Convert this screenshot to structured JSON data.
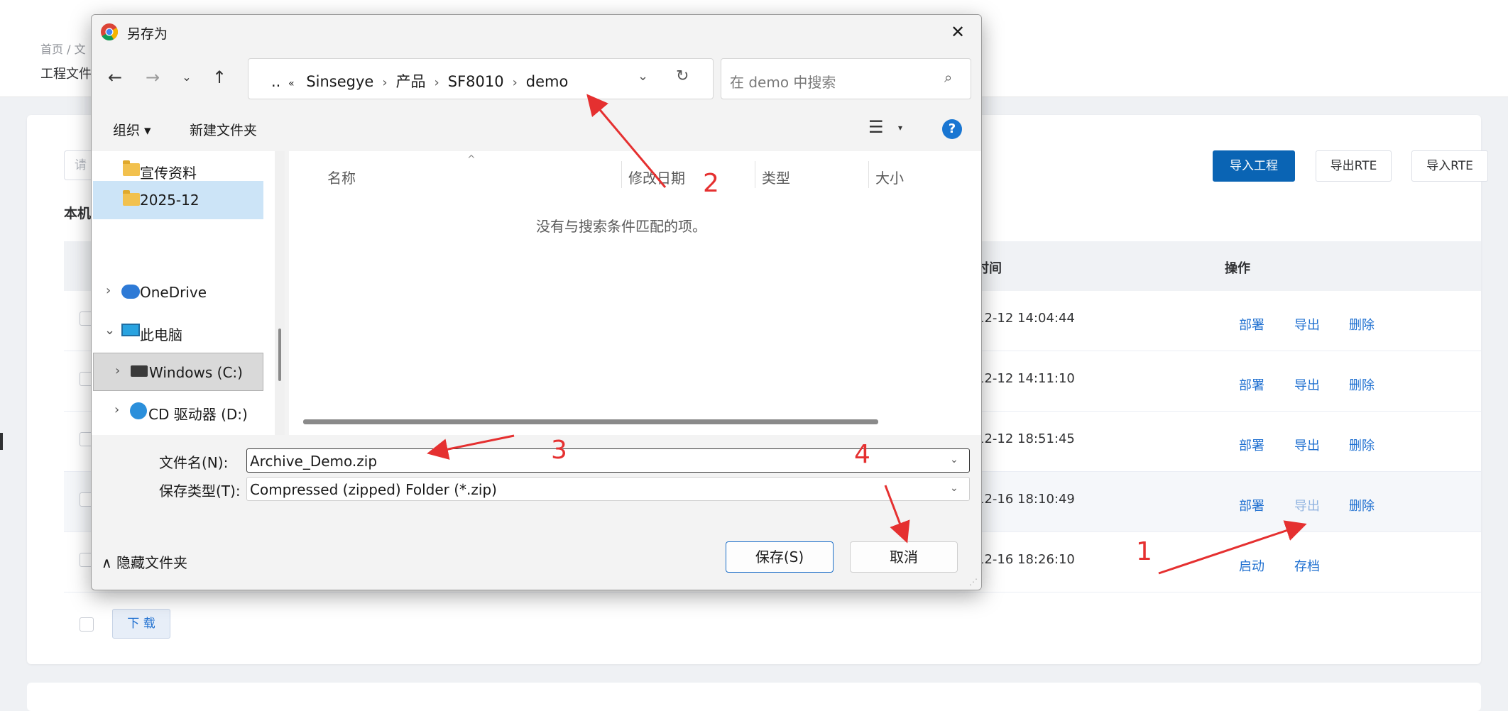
{
  "background": {
    "breadcrumb": "首页 / 文",
    "page_title": "工程文件",
    "search_placeholder": "请",
    "section_label": "本机",
    "toolbar": {
      "import_project": "导入工程",
      "export_rte": "导出RTE",
      "import_rte": "导入RTE"
    },
    "table": {
      "col_time": "时间",
      "col_ops": "操作",
      "rows": [
        {
          "time": "12-12 14:04:44",
          "ops": [
            "部署",
            "导出",
            "删除"
          ]
        },
        {
          "time": "12-12 14:11:10",
          "ops": [
            "部署",
            "导出",
            "删除"
          ]
        },
        {
          "time": "12-12 18:51:45",
          "ops": [
            "部署",
            "导出",
            "删除"
          ]
        },
        {
          "time": "12-16 18:10:49",
          "ops": [
            "部署",
            "导出",
            "删除"
          ]
        },
        {
          "time": "12-16 18:26:10",
          "ops": [
            "启动",
            "存档"
          ]
        }
      ]
    },
    "download_label": "下 载"
  },
  "dialog": {
    "title": "另存为",
    "close_glyph": "✕",
    "nav": {
      "back": "←",
      "forward": "→",
      "recent": "⌄",
      "up": "↑"
    },
    "address": {
      "overflow": "..",
      "chevrons": "«",
      "crumbs": [
        "Sinsegye",
        "产品",
        "SF8010",
        "demo"
      ],
      "separator": "›",
      "dropdown": "⌄",
      "refresh": "↻"
    },
    "search_placeholder": "在 demo 中搜索",
    "search_glyph": "⌕",
    "commands": {
      "organize": "组织 ▾",
      "new_folder": "新建文件夹",
      "view_glyph": "☰",
      "view_caret": "▾",
      "help": "?"
    },
    "nav_pane": [
      {
        "label": "宣传资料",
        "type": "folder"
      },
      {
        "label": "2025-12",
        "type": "folder",
        "selected": true
      },
      {
        "label": "OneDrive",
        "type": "cloud",
        "chevron": "›"
      },
      {
        "label": "此电脑",
        "type": "pc",
        "chevron": "⌄"
      },
      {
        "label": "Windows  (C:)",
        "type": "drive",
        "chevron": "›"
      },
      {
        "label": "CD 驱动器 (D:)",
        "type": "cd",
        "chevron": "›"
      }
    ],
    "columns": [
      "名称",
      "修改日期",
      "类型",
      "大小"
    ],
    "sort_glyph": "^",
    "empty_message": "没有与搜索条件匹配的项。",
    "filename_label": "文件名(N):",
    "filename_value": "Archive_Demo.zip",
    "filetype_label": "保存类型(T):",
    "filetype_value": "Compressed (zipped) Folder (*.zip)",
    "field_caret": "⌄",
    "hide_folders": "∧ 隐藏文件夹",
    "save_label": "保存(S)",
    "cancel_label": "取消",
    "resize_glyph": "⋰"
  },
  "annotations": {
    "color": "#e53030",
    "labels": [
      "1",
      "2",
      "3",
      "4"
    ]
  }
}
